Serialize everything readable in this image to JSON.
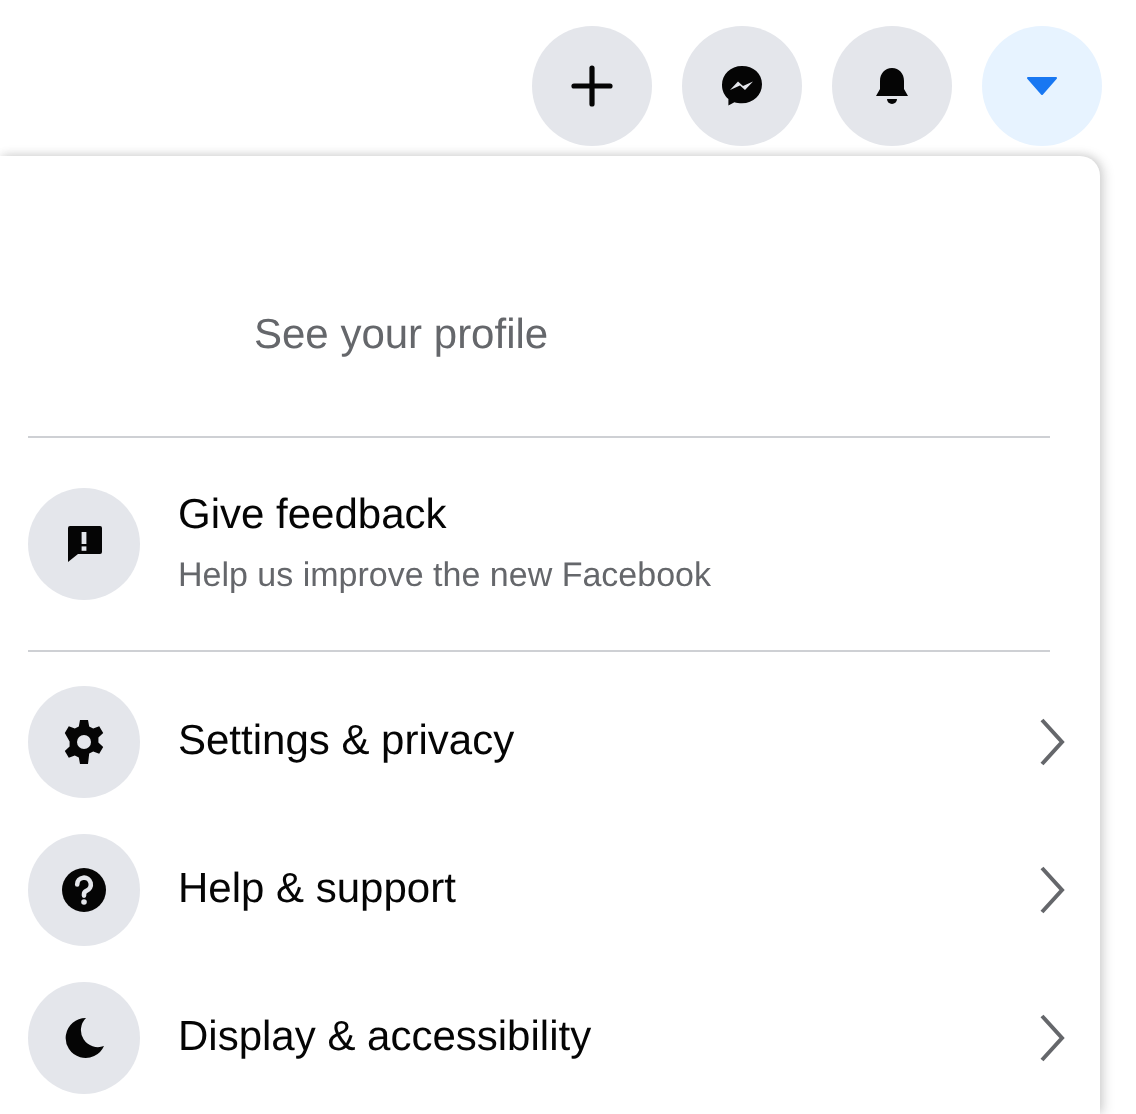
{
  "top_buttons": [
    {
      "kind": "plus",
      "selected": false
    },
    {
      "kind": "messenger",
      "selected": false
    },
    {
      "kind": "bell",
      "selected": false
    },
    {
      "kind": "caret",
      "selected": true
    }
  ],
  "profile": {
    "link": "See your profile"
  },
  "feedback": {
    "title": "Give feedback",
    "subtitle": "Help us improve the new Facebook"
  },
  "menu_items": [
    {
      "kind": "gear",
      "label": "Settings & privacy"
    },
    {
      "kind": "help",
      "label": "Help & support"
    },
    {
      "kind": "moon",
      "label": "Display & accessibility"
    }
  ]
}
